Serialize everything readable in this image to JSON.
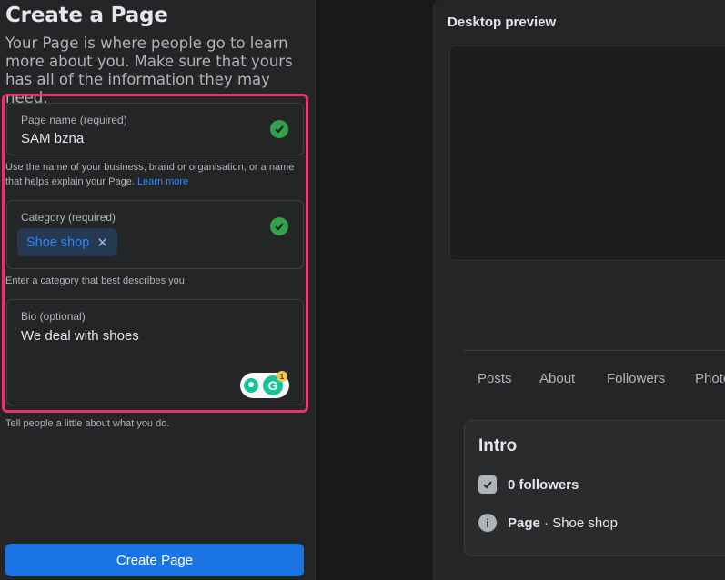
{
  "form": {
    "title": "Create a Page",
    "description": "Your Page is where people go to learn more about you. Make sure that yours has all of the information they may need.",
    "page_name": {
      "label": "Page name (required)",
      "value": "SAM bzna",
      "helper": "Use the name of your business, brand or organisation, or a name that helps explain your Page.",
      "helper_link": "Learn more"
    },
    "category": {
      "label": "Category (required)",
      "chip": "Shoe shop",
      "remove_icon": "✕",
      "helper": "Enter a category that best describes you."
    },
    "bio": {
      "label": "Bio (optional)",
      "value": "We deal with shoes",
      "helper": "Tell people a little about what you do.",
      "grammarly_logo": "G",
      "grammarly_badge": "1"
    },
    "create_button": "Create Page"
  },
  "preview": {
    "title": "Desktop preview",
    "tabs": [
      "Posts",
      "About",
      "Followers",
      "Photo"
    ],
    "intro": {
      "title": "Intro",
      "followers": "0 followers",
      "page_label": "Page",
      "page_sep": " · ",
      "page_category": "Shoe shop",
      "info_icon": "i"
    }
  },
  "colors": {
    "accent": "#1b74e4",
    "highlight_border": "#e8336c",
    "success": "#31a24c",
    "link": "#2d88ff"
  }
}
